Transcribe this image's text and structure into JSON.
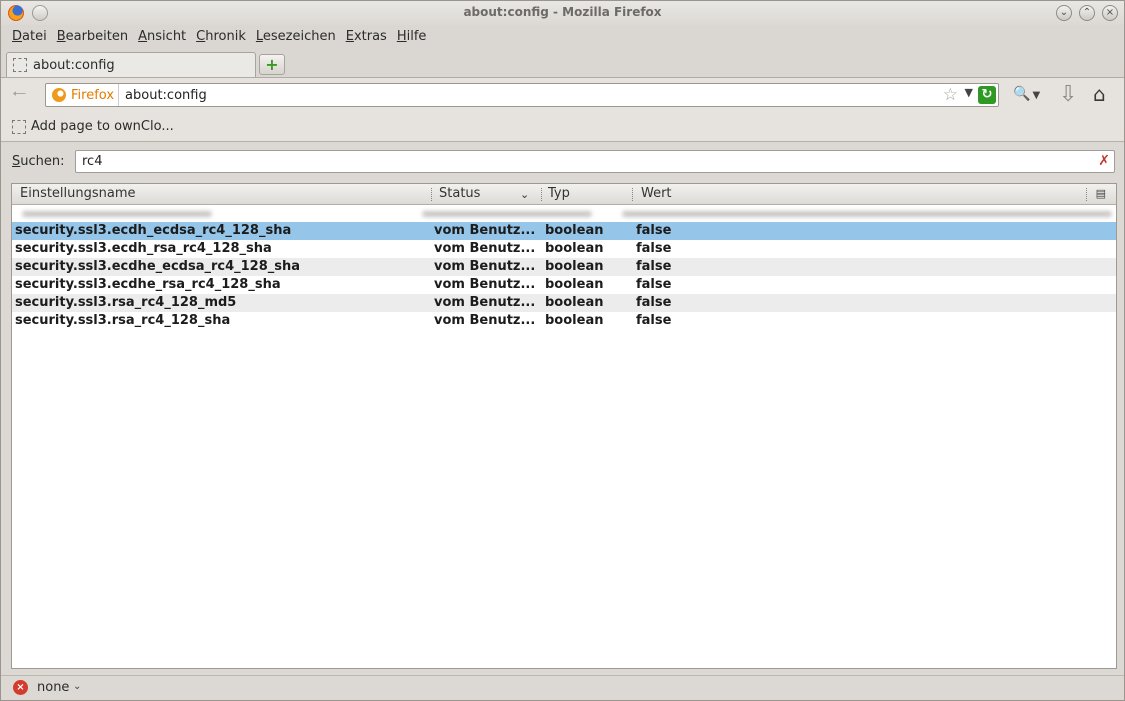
{
  "window": {
    "title": "about:config - Mozilla Firefox"
  },
  "menubar": {
    "items": [
      {
        "accel": "D",
        "rest": "atei"
      },
      {
        "accel": "B",
        "rest": "earbeiten"
      },
      {
        "accel": "A",
        "rest": "nsicht"
      },
      {
        "accel": "C",
        "rest": "hronik"
      },
      {
        "accel": "L",
        "rest": "esezeichen"
      },
      {
        "accel": "E",
        "rest": "xtras"
      },
      {
        "accel": "H",
        "rest": "ilfe"
      }
    ]
  },
  "tab": {
    "label": "about:config"
  },
  "urlbar": {
    "identity_label": "Firefox",
    "url": "about:config"
  },
  "bookmarks": {
    "item_label": "Add page to ownClo..."
  },
  "filter": {
    "label_accel": "S",
    "label_rest": "uchen:",
    "value": "rc4"
  },
  "tree": {
    "columns": {
      "name": "Einstellungsname",
      "status": "Status",
      "type": "Typ",
      "value": "Wert"
    },
    "rows": [
      {
        "name": "security.ssl3.ecdh_ecdsa_rc4_128_sha",
        "status": "vom Benutz...",
        "type": "boolean",
        "value": "false"
      },
      {
        "name": "security.ssl3.ecdh_rsa_rc4_128_sha",
        "status": "vom Benutz...",
        "type": "boolean",
        "value": "false"
      },
      {
        "name": "security.ssl3.ecdhe_ecdsa_rc4_128_sha",
        "status": "vom Benutz...",
        "type": "boolean",
        "value": "false"
      },
      {
        "name": "security.ssl3.ecdhe_rsa_rc4_128_sha",
        "status": "vom Benutz...",
        "type": "boolean",
        "value": "false"
      },
      {
        "name": "security.ssl3.rsa_rc4_128_md5",
        "status": "vom Benutz...",
        "type": "boolean",
        "value": "false"
      },
      {
        "name": "security.ssl3.rsa_rc4_128_sha",
        "status": "vom Benutz...",
        "type": "boolean",
        "value": "false"
      }
    ],
    "selected_index": 0
  },
  "statusbar": {
    "text": "none"
  },
  "icons": {
    "app": "firefox-logo-icon",
    "back": "back-arrow-icon",
    "star": "bookmark-star-icon",
    "reload": "reload-icon",
    "search": "search-engine-icon",
    "download": "download-icon",
    "home": "home-icon",
    "clear": "clear-filter-icon",
    "status": "error-icon"
  }
}
